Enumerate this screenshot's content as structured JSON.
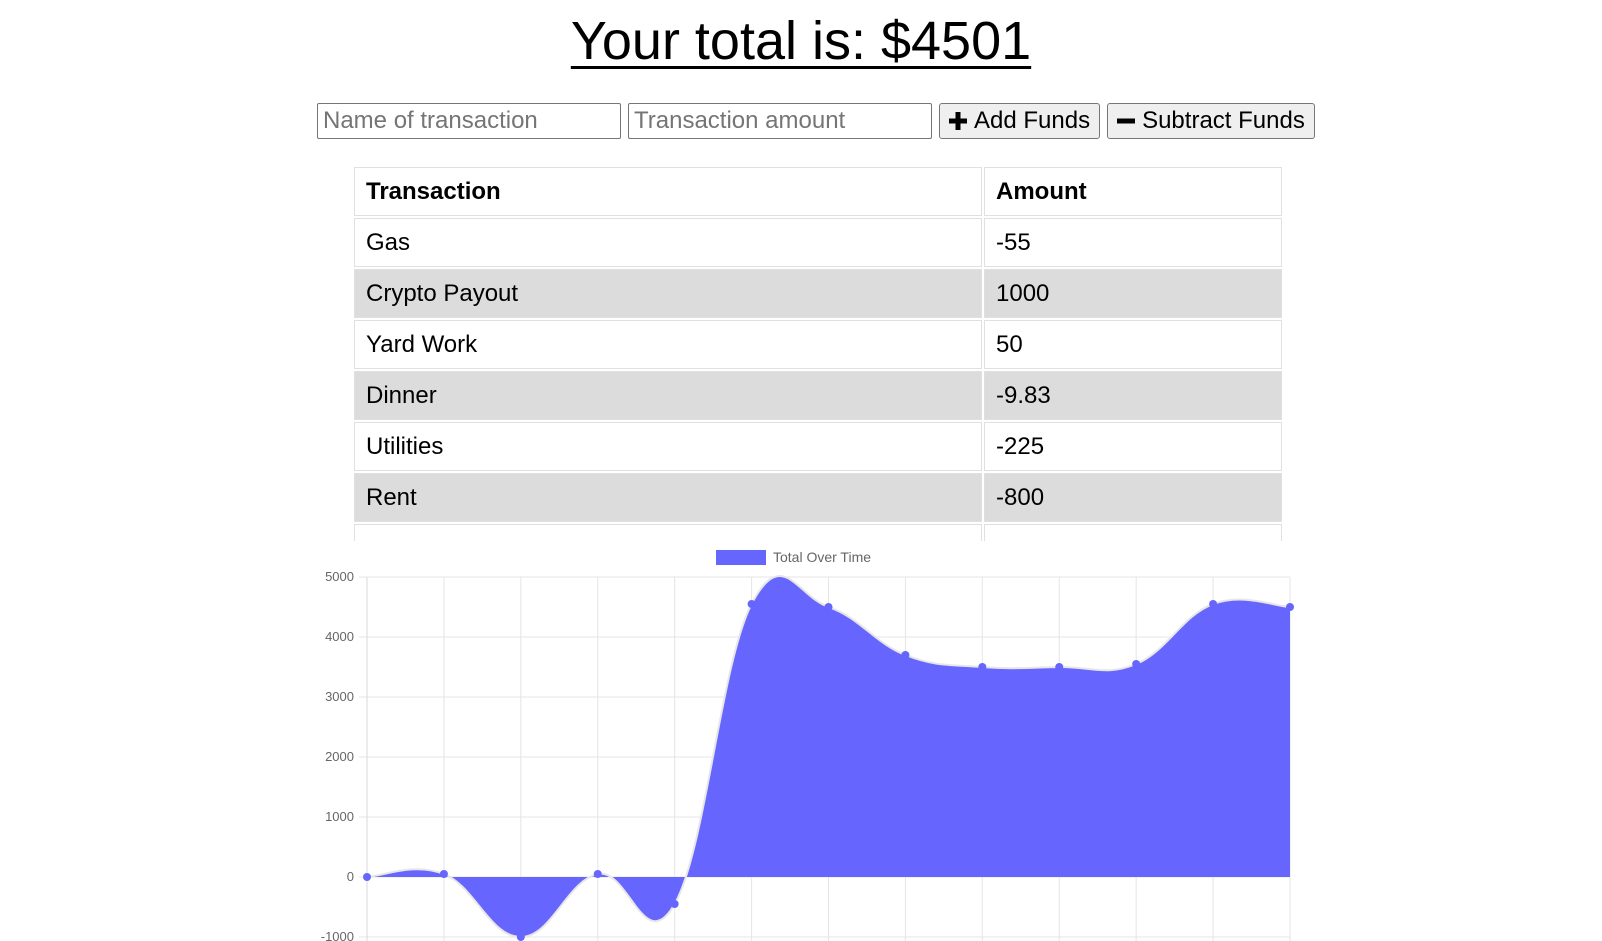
{
  "header": {
    "title": "Your total is: $4501"
  },
  "form": {
    "name_placeholder": "Name of transaction",
    "amount_placeholder": "Transaction amount",
    "add_label": "Add Funds",
    "subtract_label": "Subtract Funds"
  },
  "table": {
    "headers": [
      "Transaction",
      "Amount"
    ],
    "rows": [
      {
        "name": "Gas",
        "amount": "-55"
      },
      {
        "name": "Crypto Payout",
        "amount": "1000"
      },
      {
        "name": "Yard Work",
        "amount": "50"
      },
      {
        "name": "Dinner",
        "amount": "-9.83"
      },
      {
        "name": "Utilities",
        "amount": "-225"
      },
      {
        "name": "Rent",
        "amount": "-800"
      }
    ]
  },
  "chart_data": {
    "type": "area",
    "title": "",
    "xlabel": "",
    "ylabel": "",
    "ylim": [
      -1000,
      5000
    ],
    "yticks": [
      5000,
      4000,
      3000,
      2000,
      1000,
      0,
      -1000
    ],
    "grid": true,
    "legend": "top",
    "series": [
      {
        "name": "Total Over Time",
        "color": "#6666ff",
        "values": [
          0,
          50,
          -1000,
          50,
          -450,
          4550,
          4500,
          3700,
          3500,
          3500,
          3550,
          4550,
          4500
        ]
      }
    ]
  }
}
